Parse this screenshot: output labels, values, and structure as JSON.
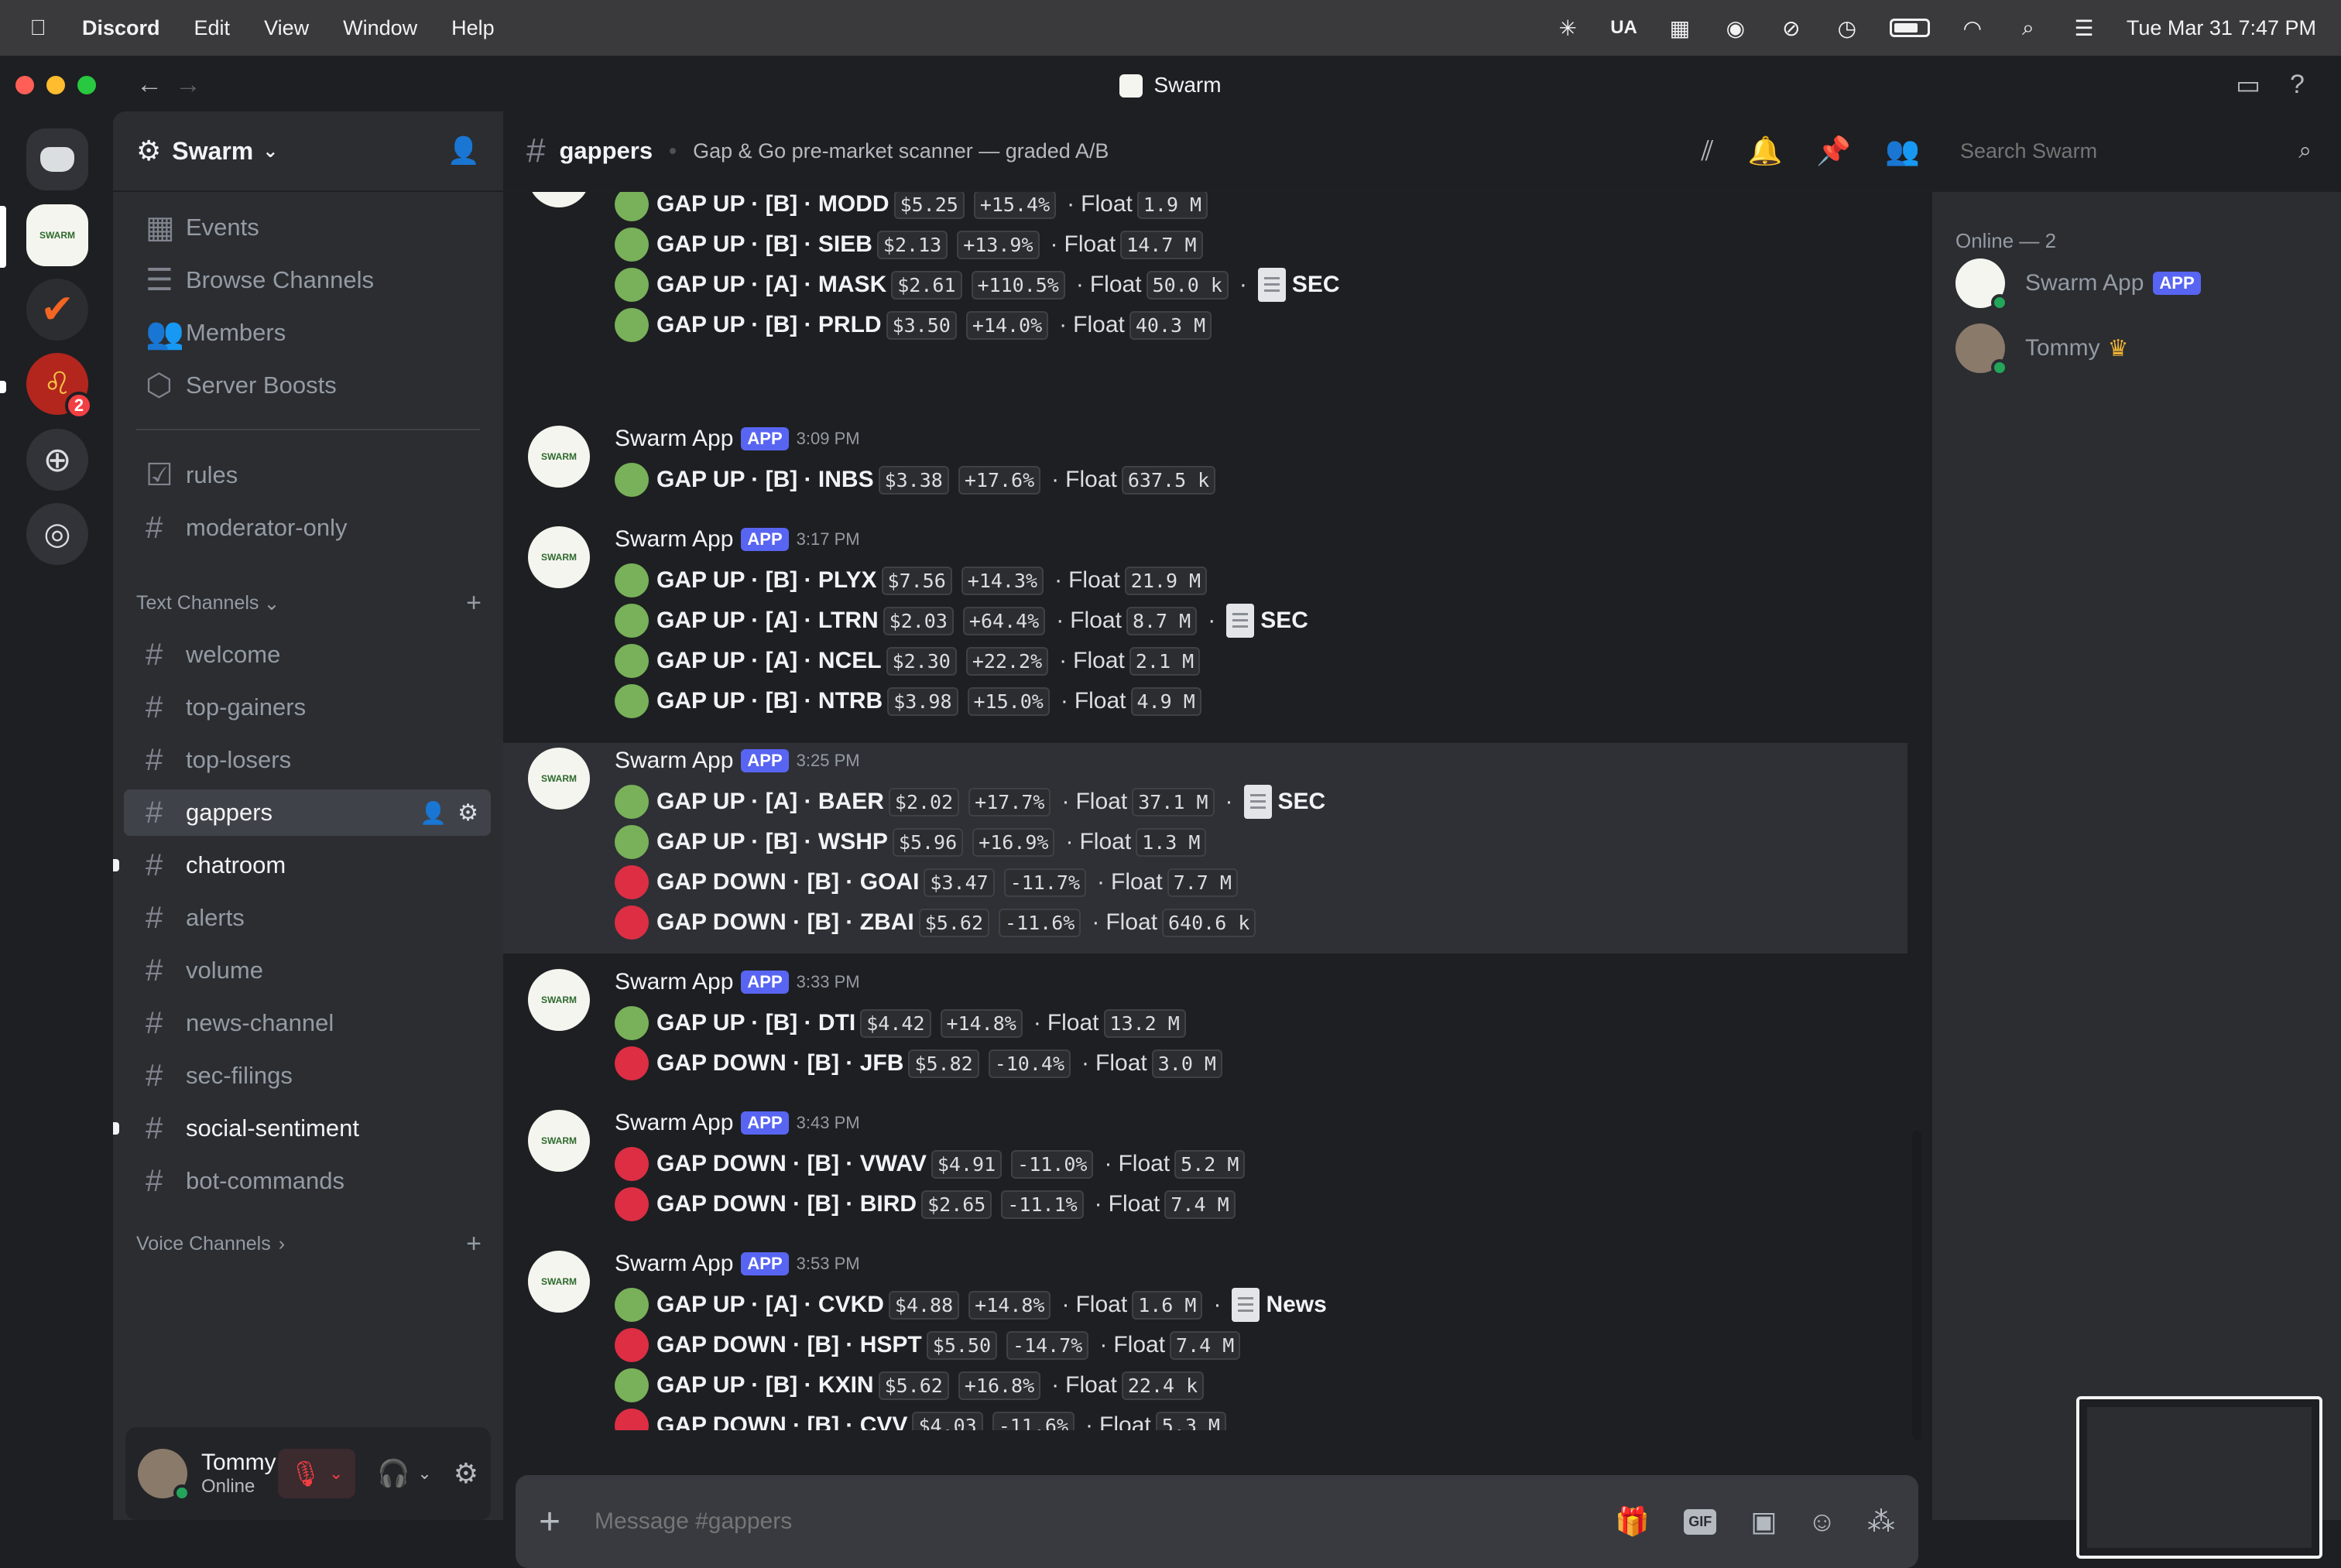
{
  "menubar": {
    "app": "Discord",
    "items": [
      "Edit",
      "View",
      "Window",
      "Help"
    ],
    "status_ua": "UA",
    "datetime": "Tue Mar 31  7:47 PM"
  },
  "window": {
    "title": "Swarm"
  },
  "servers": {
    "badge": "2"
  },
  "sidebar": {
    "server_name": "Swarm",
    "top_items": [
      {
        "label": "Events",
        "icon": "calendar-icon"
      },
      {
        "label": "Browse Channels",
        "icon": "list-icon"
      },
      {
        "label": "Members",
        "icon": "members-icon"
      },
      {
        "label": "Server Boosts",
        "icon": "boost-icon"
      }
    ],
    "pinned_channels": [
      {
        "label": "rules",
        "icon": "rules-icon"
      },
      {
        "label": "moderator-only",
        "icon": "hash-icon"
      }
    ],
    "text_category": "Text Channels",
    "text_channels": [
      {
        "label": "welcome"
      },
      {
        "label": "top-gainers"
      },
      {
        "label": "top-losers"
      },
      {
        "label": "gappers",
        "selected": true
      },
      {
        "label": "chatroom",
        "unread": true
      },
      {
        "label": "alerts"
      },
      {
        "label": "volume"
      },
      {
        "label": "news-channel"
      },
      {
        "label": "sec-filings"
      },
      {
        "label": "social-sentiment",
        "unread": true
      },
      {
        "label": "bot-commands"
      }
    ],
    "voice_category": "Voice Channels"
  },
  "user": {
    "name": "Tommy",
    "status": "Online"
  },
  "channel": {
    "name": "gappers",
    "topic": "Gap & Go pre-market scanner — graded A/B",
    "search_placeholder": "Search Swarm"
  },
  "composer": {
    "placeholder": "Message #gappers"
  },
  "members": {
    "header": "Online — 2",
    "list": [
      {
        "name": "Swarm App",
        "tag": "APP"
      },
      {
        "name": "Tommy",
        "crown": "♛"
      }
    ]
  },
  "messages": [
    {
      "author": null,
      "lines": [
        {
          "dir": "up",
          "text": "GAP UP · [B] · MODD",
          "price": "$5.25",
          "chg": "+15.4%",
          "float": "1.9 M"
        },
        {
          "dir": "up",
          "text": "GAP UP · [B] · SIEB",
          "price": "$2.13",
          "chg": "+13.9%",
          "float": "14.7 M"
        },
        {
          "dir": "up",
          "text": "GAP UP · [A] · MASK",
          "price": "$2.61",
          "chg": "+110.5%",
          "float": "50.0 k",
          "extra": "SEC"
        },
        {
          "dir": "up",
          "text": "GAP UP · [B] · PRLD",
          "price": "$3.50",
          "chg": "+14.0%",
          "float": "40.3 M"
        }
      ]
    },
    {
      "author": "Swarm App",
      "tag": "APP",
      "time": "3:09 PM",
      "lines": [
        {
          "dir": "up",
          "text": "GAP UP · [B] · INBS",
          "price": "$3.38",
          "chg": "+17.6%",
          "float": "637.5 k"
        }
      ]
    },
    {
      "author": "Swarm App",
      "tag": "APP",
      "time": "3:17 PM",
      "lines": [
        {
          "dir": "up",
          "text": "GAP UP · [B] · PLYX",
          "price": "$7.56",
          "chg": "+14.3%",
          "float": "21.9 M"
        },
        {
          "dir": "up",
          "text": "GAP UP · [A] · LTRN",
          "price": "$2.03",
          "chg": "+64.4%",
          "float": "8.7 M",
          "extra": "SEC"
        },
        {
          "dir": "up",
          "text": "GAP UP · [A] · NCEL",
          "price": "$2.30",
          "chg": "+22.2%",
          "float": "2.1 M"
        },
        {
          "dir": "up",
          "text": "GAP UP · [B] · NTRB",
          "price": "$3.98",
          "chg": "+15.0%",
          "float": "4.9 M"
        }
      ]
    },
    {
      "author": "Swarm App",
      "tag": "APP",
      "time": "3:25 PM",
      "highlight": true,
      "lines": [
        {
          "dir": "up",
          "text": "GAP UP · [A] · BAER",
          "price": "$2.02",
          "chg": "+17.7%",
          "float": "37.1 M",
          "extra": "SEC"
        },
        {
          "dir": "up",
          "text": "GAP UP · [B] · WSHP",
          "price": "$5.96",
          "chg": "+16.9%",
          "float": "1.3 M"
        },
        {
          "dir": "down",
          "text": "GAP DOWN · [B] · GOAI",
          "price": "$3.47",
          "chg": "-11.7%",
          "float": "7.7 M"
        },
        {
          "dir": "down",
          "text": "GAP DOWN · [B] · ZBAI",
          "price": "$5.62",
          "chg": "-11.6%",
          "float": "640.6 k"
        }
      ]
    },
    {
      "author": "Swarm App",
      "tag": "APP",
      "time": "3:33 PM",
      "lines": [
        {
          "dir": "up",
          "text": "GAP UP · [B] · DTI",
          "price": "$4.42",
          "chg": "+14.8%",
          "float": "13.2 M"
        },
        {
          "dir": "down",
          "text": "GAP DOWN · [B] · JFB",
          "price": "$5.82",
          "chg": "-10.4%",
          "float": "3.0 M"
        }
      ]
    },
    {
      "author": "Swarm App",
      "tag": "APP",
      "time": "3:43 PM",
      "lines": [
        {
          "dir": "down",
          "text": "GAP DOWN · [B] · VWAV",
          "price": "$4.91",
          "chg": "-11.0%",
          "float": "5.2 M"
        },
        {
          "dir": "down",
          "text": "GAP DOWN · [B] · BIRD",
          "price": "$2.65",
          "chg": "-11.1%",
          "float": "7.4 M"
        }
      ]
    },
    {
      "author": "Swarm App",
      "tag": "APP",
      "time": "3:53 PM",
      "lines": [
        {
          "dir": "up",
          "text": "GAP UP · [A] · CVKD",
          "price": "$4.88",
          "chg": "+14.8%",
          "float": "1.6 M",
          "extra": "News"
        },
        {
          "dir": "down",
          "text": "GAP DOWN · [B] · HSPT",
          "price": "$5.50",
          "chg": "-14.7%",
          "float": "7.4 M"
        },
        {
          "dir": "up",
          "text": "GAP UP · [B] · KXIN",
          "price": "$5.62",
          "chg": "+16.8%",
          "float": "22.4 k"
        },
        {
          "dir": "down",
          "text": "GAP DOWN · [B] · CVV",
          "price": "$4.03",
          "chg": "-11.6%",
          "float": "5.3 M"
        }
      ]
    }
  ],
  "labels": {
    "float": "Float",
    "avatar_text": "SWARM"
  },
  "colors": {
    "accent": "#5865f2",
    "up": "#78b159",
    "down": "#dd2e44",
    "online": "#23a55a",
    "muted_red": "#f23f43"
  }
}
